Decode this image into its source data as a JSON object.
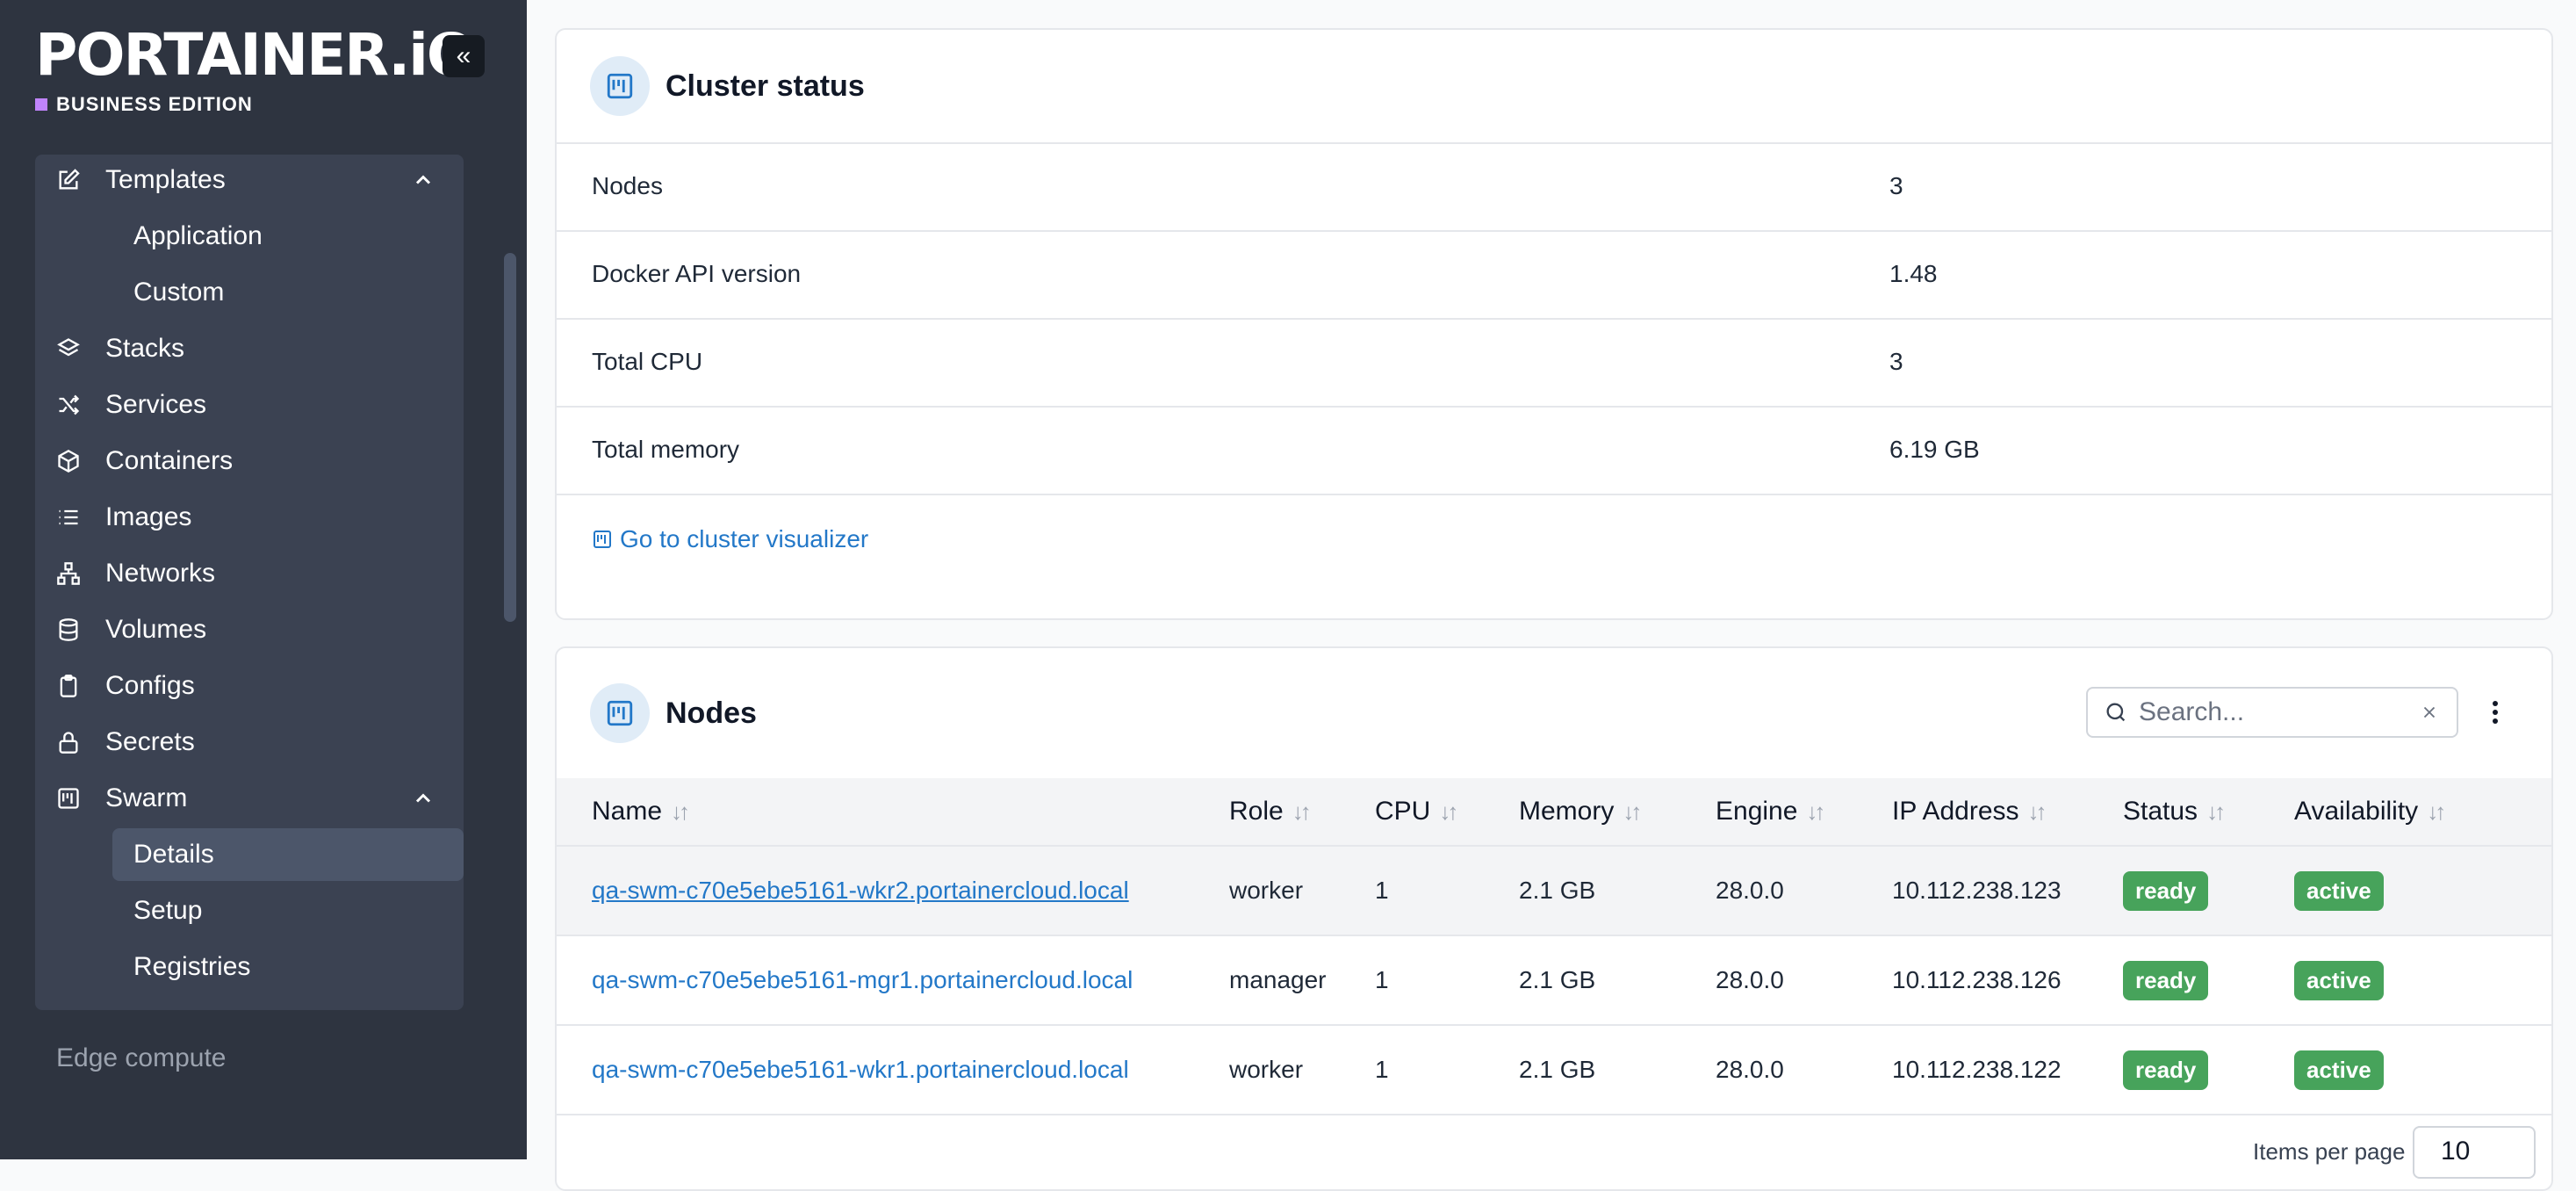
{
  "brand": {
    "logo_text": "PORTAINER.iO",
    "edition": "BUSINESS EDITION"
  },
  "sidebar": {
    "collapse_icon": "«",
    "items": [
      {
        "label": "Templates",
        "icon": "edit-icon",
        "expanded": true
      },
      {
        "label": "Stacks",
        "icon": "layers-icon"
      },
      {
        "label": "Services",
        "icon": "shuffle-icon"
      },
      {
        "label": "Containers",
        "icon": "box-icon"
      },
      {
        "label": "Images",
        "icon": "list-icon"
      },
      {
        "label": "Networks",
        "icon": "network-icon"
      },
      {
        "label": "Volumes",
        "icon": "database-icon"
      },
      {
        "label": "Configs",
        "icon": "clipboard-icon"
      },
      {
        "label": "Secrets",
        "icon": "lock-icon"
      },
      {
        "label": "Swarm",
        "icon": "swarm-icon",
        "expanded": true
      }
    ],
    "templates_sub": [
      "Application",
      "Custom"
    ],
    "swarm_sub": [
      "Details",
      "Setup",
      "Registries"
    ],
    "active_sub": "Details",
    "footer_label": "Edge compute"
  },
  "cluster_status": {
    "title": "Cluster status",
    "rows": [
      {
        "key": "Nodes",
        "value": "3"
      },
      {
        "key": "Docker API version",
        "value": "1.48"
      },
      {
        "key": "Total CPU",
        "value": "3"
      },
      {
        "key": "Total memory",
        "value": "6.19 GB"
      }
    ],
    "link_label": "Go to cluster visualizer"
  },
  "nodes": {
    "title": "Nodes",
    "search_placeholder": "Search...",
    "columns": [
      "Name",
      "Role",
      "CPU",
      "Memory",
      "Engine",
      "IP Address",
      "Status",
      "Availability"
    ],
    "rows": [
      {
        "name": "qa-swm-c70e5ebe5161-wkr2.portainercloud.local",
        "role": "worker",
        "cpu": "1",
        "memory": "2.1 GB",
        "engine": "28.0.0",
        "ip": "10.112.238.123",
        "status": "ready",
        "availability": "active"
      },
      {
        "name": "qa-swm-c70e5ebe5161-mgr1.portainercloud.local",
        "role": "manager",
        "cpu": "1",
        "memory": "2.1 GB",
        "engine": "28.0.0",
        "ip": "10.112.238.126",
        "status": "ready",
        "availability": "active"
      },
      {
        "name": "qa-swm-c70e5ebe5161-wkr1.portainercloud.local",
        "role": "worker",
        "cpu": "1",
        "memory": "2.1 GB",
        "engine": "28.0.0",
        "ip": "10.112.238.122",
        "status": "ready",
        "availability": "active"
      }
    ],
    "items_per_page_label": "Items per page",
    "items_per_page_value": "10"
  },
  "colors": {
    "sidebar_bg": "#2e3440",
    "link": "#2378c8",
    "badge_green": "#47a35b",
    "edition_square": "#c084fc"
  }
}
